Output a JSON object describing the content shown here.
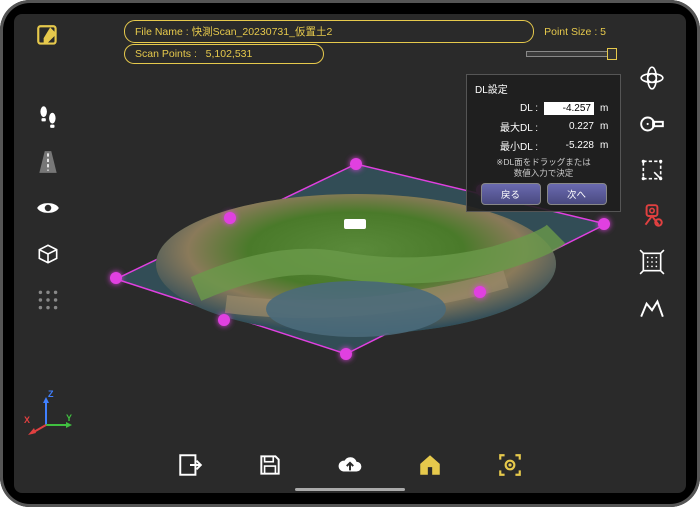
{
  "header": {
    "file_label_prefix": "File Name : ",
    "file_name": "快測Scan_20230731_仮置土2",
    "points_label_prefix": "Scan Points : ",
    "points": "5,102,531",
    "point_size_label": "Point Size :  5"
  },
  "panel": {
    "title": "DL設定",
    "dl_label": "DL :",
    "dl_value": "-4.257",
    "max_label": "最大DL :",
    "max_value": "0.227",
    "min_label": "最小DL :",
    "min_value": "-5.228",
    "unit": "m",
    "note_line1": "※DL面をドラッグまたは",
    "note_line2": "数値入力で決定",
    "back": "戻る",
    "next": "次へ"
  },
  "axis": {
    "x": "X",
    "y": "Y",
    "z": "Z"
  },
  "colors": {
    "accent": "#e6c94c",
    "handle": "#e040e0",
    "danger": "#e04040"
  }
}
